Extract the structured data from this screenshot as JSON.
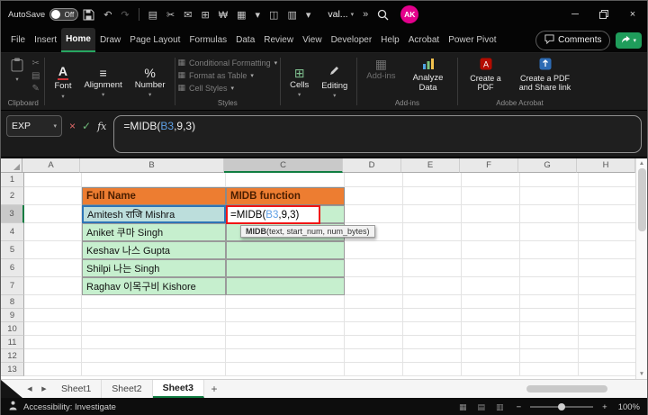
{
  "titlebar": {
    "autosave_label": "AutoSave",
    "autosave_state": "Off",
    "undo_glyph": "↶",
    "redo_glyph": "↷",
    "qat": [
      {
        "name": "clipboard-icon",
        "glyph": "▤"
      },
      {
        "name": "scissors-icon",
        "glyph": "✂"
      },
      {
        "name": "mail-icon",
        "glyph": "✉"
      },
      {
        "name": "borders-icon",
        "glyph": "⊞"
      },
      {
        "name": "currency-icon",
        "glyph": "₩"
      },
      {
        "name": "table-icon",
        "glyph": "▦"
      },
      {
        "name": "dropdown-icon",
        "glyph": "▾"
      },
      {
        "name": "window-icon",
        "glyph": "◫"
      },
      {
        "name": "rows-icon",
        "glyph": "▥"
      },
      {
        "name": "dropdown2-icon",
        "glyph": "▾"
      }
    ],
    "doc_name": "val...",
    "overflow_chevron": "»",
    "avatar_initials": "AK",
    "minimize_glyph": "─",
    "close_glyph": "×"
  },
  "menu": {
    "tabs": [
      "File",
      "Insert",
      "Home",
      "Draw",
      "Page Layout",
      "Formulas",
      "Data",
      "Review",
      "View",
      "Developer",
      "Help",
      "Acrobat",
      "Power Pivot"
    ],
    "active": "Home",
    "comments_label": "Comments"
  },
  "ribbon": {
    "paste_label": "Paste",
    "font_label": "Font",
    "alignment_label": "Alignment",
    "number_label": "Number",
    "alignment_glyph": "≡",
    "number_glyph": "%",
    "cells_glyph": "⊞",
    "styles_items": [
      "Conditional Formatting",
      "Format as Table",
      "Cell Styles"
    ],
    "cells_label": "Cells",
    "editing_label": "Editing",
    "addins_label": "Add-ins",
    "analyze_label": "Analyze Data",
    "pdf_label": "Create a PDF",
    "pdf_share_label": "Create a PDF and Share link",
    "group_labels": {
      "clipboard": "Clipboard",
      "styles": "Styles",
      "addins": "Add-ins",
      "adobe": "Adobe Acrobat"
    }
  },
  "formula": {
    "name_box": "EXP",
    "prefix": "=MIDB(",
    "ref": "B3",
    "suffix": ",9,3)"
  },
  "grid": {
    "columns": [
      "A",
      "B",
      "C",
      "D",
      "E",
      "F",
      "G",
      "H"
    ],
    "row_count": 13,
    "selected_col": "C",
    "selected_row": 3,
    "content": {
      "B2": "Full Name",
      "C2": "MIDB function",
      "B3": "Amitesh राजि Mishra",
      "B4": "Aniket 쿠마 Singh",
      "B5": "Keshav 나스 Gupta",
      "B6": "Shilpi 나는 Singh",
      "B7": "Raghav 이목구비 Kishore"
    },
    "cell_styles": {
      "B2": "orange",
      "C2": "orange",
      "B3": "green ref-cell",
      "C3": "editing",
      "B4": "green",
      "B5": "green",
      "B6": "green",
      "B7": "green",
      "C4": "green",
      "C5": "green",
      "C6": "green",
      "C7": "green"
    },
    "tooltip": {
      "fn": "MIDB",
      "args": "(text, start_num, num_bytes)"
    }
  },
  "sheets": {
    "items": [
      "Sheet1",
      "Sheet2",
      "Sheet3"
    ],
    "active": "Sheet3",
    "add_label": "+"
  },
  "status": {
    "accessibility": "Accessibility: Investigate",
    "zoom": "100%",
    "view_icons": [
      "▦",
      "▤",
      "▥"
    ]
  },
  "colors": {
    "accent_green": "#107C41",
    "header_orange": "#ED7D31",
    "cell_green": "#C6EFCE",
    "ref_blue": "#2E75B6",
    "edit_red": "#F01414",
    "avatar_pink": "#E3008C"
  }
}
